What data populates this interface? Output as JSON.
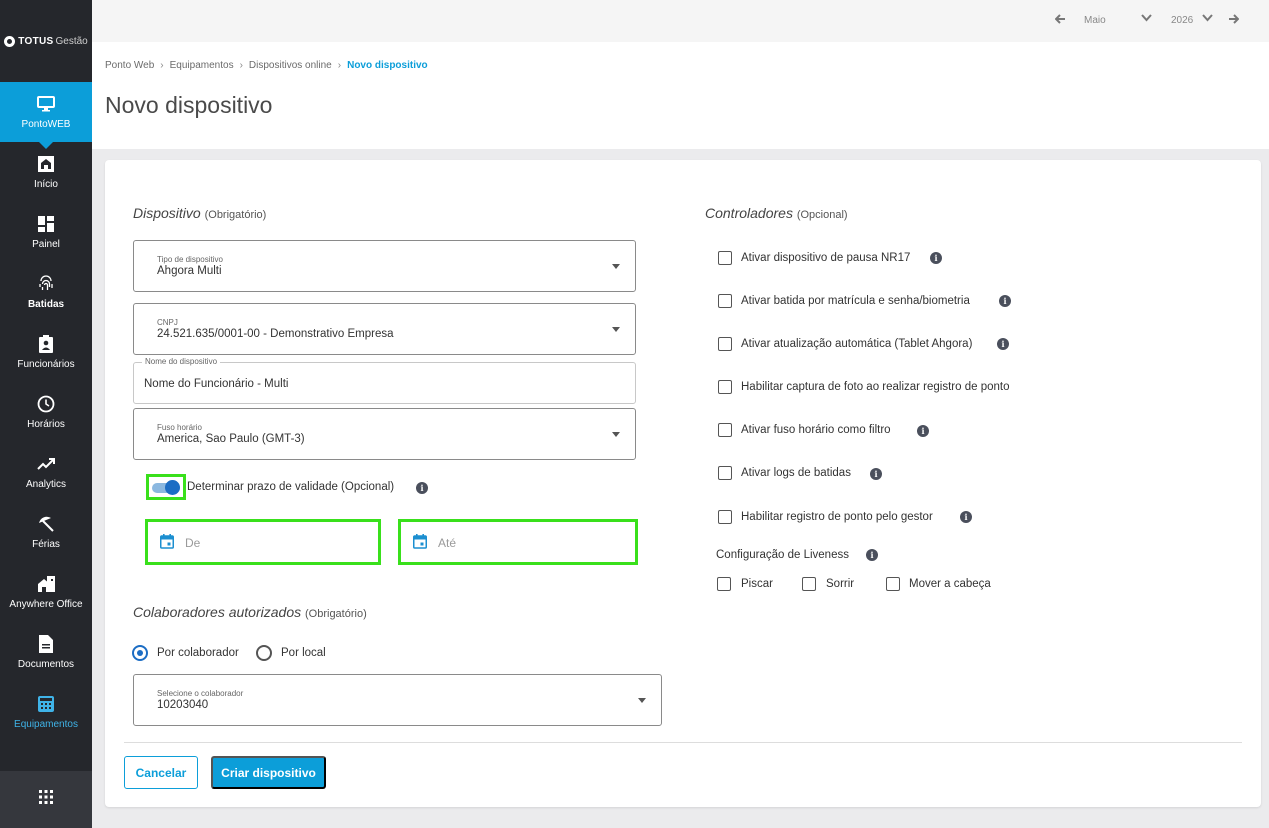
{
  "brand": {
    "name": "TOTUS",
    "sub": "Gestão"
  },
  "topbar": {
    "month": "Maio",
    "year": "2026"
  },
  "sidebar": {
    "items": [
      {
        "label": "PontoWEB",
        "icon": "monitor-icon"
      },
      {
        "label": "Início",
        "icon": "home-icon"
      },
      {
        "label": "Painel",
        "icon": "dashboard-icon"
      },
      {
        "label": "Batidas",
        "icon": "fingerprint-icon"
      },
      {
        "label": "Funcionários",
        "icon": "badge-icon"
      },
      {
        "label": "Horários",
        "icon": "clock-icon"
      },
      {
        "label": "Analytics",
        "icon": "trending-icon"
      },
      {
        "label": "Férias",
        "icon": "beach-icon"
      },
      {
        "label": "Anywhere Office",
        "icon": "home-work-icon"
      },
      {
        "label": "Documentos",
        "icon": "document-icon"
      },
      {
        "label": "Equipamentos",
        "icon": "calculator-icon"
      }
    ]
  },
  "breadcrumb": [
    "Ponto Web",
    "Equipamentos",
    "Dispositivos online",
    "Novo dispositivo"
  ],
  "page_title": "Novo dispositivo",
  "dispositivo": {
    "title": "Dispositivo",
    "tag": "(Obrigatório)",
    "tipo": {
      "label": "Tipo de dispositivo",
      "value": "Ahgora Multi"
    },
    "cnpj": {
      "label": "CNPJ",
      "value": "24.521.635/0001-00 - Demonstrativo Empresa"
    },
    "nome": {
      "label": "Nome do dispositivo",
      "value": "Nome do Funcionário - Multi"
    },
    "fuso": {
      "label": "Fuso horário",
      "value": "America, Sao Paulo (GMT-3)"
    },
    "validade_label": "Determinar prazo de validade (Opcional)",
    "validade_on": true,
    "de_placeholder": "De",
    "ate_placeholder": "Até"
  },
  "colaboradores": {
    "title": "Colaboradores autorizados",
    "tag": "(Obrigatório)",
    "opt1": "Por colaborador",
    "opt2": "Por local",
    "selected": "Por colaborador",
    "select": {
      "label": "Selecione o colaborador",
      "value": "10203040"
    }
  },
  "controladores": {
    "title": "Controladores",
    "tag": "(Opcional)",
    "options": [
      "Ativar dispositivo de pausa NR17",
      "Ativar batida por matrícula e senha/biometria",
      "Ativar atualização automática (Tablet Ahgora)",
      "Habilitar captura de foto ao realizar registro de ponto",
      "Ativar fuso horário como filtro",
      "Ativar logs de batidas",
      "Habilitar registro de ponto pelo gestor"
    ],
    "liveness_title": "Configuração de Liveness",
    "liveness": [
      "Piscar",
      "Sorrir",
      "Mover a cabeça"
    ]
  },
  "actions": {
    "cancel": "Cancelar",
    "create": "Criar dispositivo"
  },
  "colors": {
    "accent": "#0c9ed9",
    "sidebar": "#25272c",
    "highlight": "#39e01b"
  }
}
